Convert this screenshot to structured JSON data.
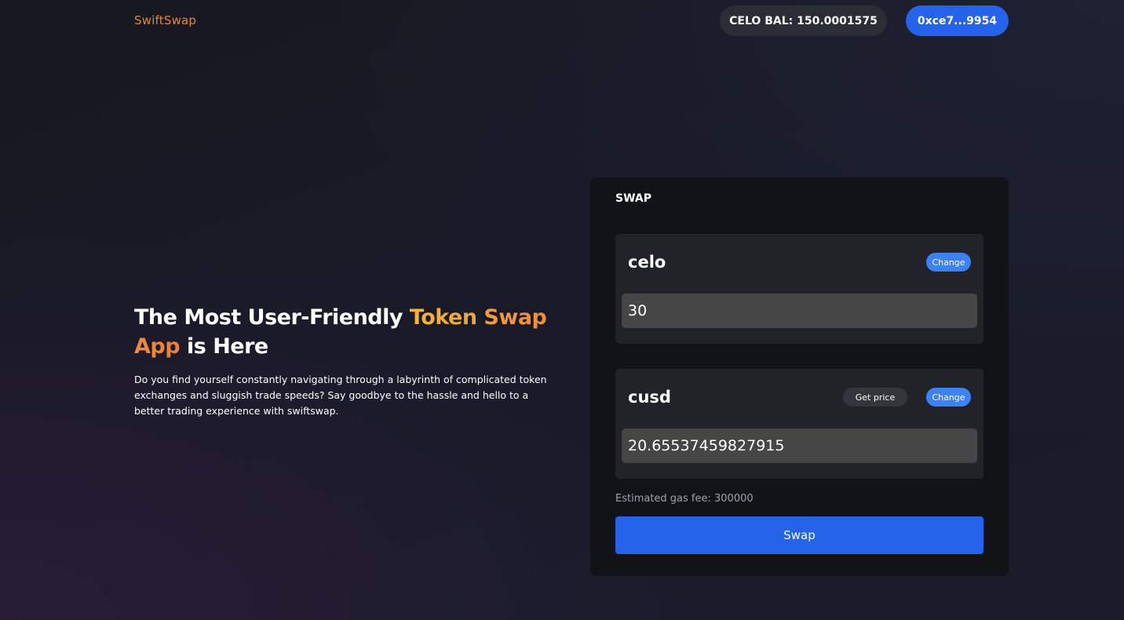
{
  "header": {
    "brand": "SwiftSwap",
    "balance": "CELO BAL: 150.0001575",
    "wallet": "0xce7...9954"
  },
  "hero": {
    "title_part1": "The Most User-Friendly ",
    "title_accent": "Token Swap App",
    "title_part2": " is Here",
    "description": "Do you find yourself constantly navigating through a labyrinth of complicated token exchanges and sluggish trade speeds? Say goodbye to the hassle and hello to a better trading experience with swiftswap."
  },
  "swap": {
    "title": "SWAP",
    "from": {
      "token": "celo",
      "change_label": "Change",
      "amount": "30"
    },
    "to": {
      "token": "cusd",
      "get_price_label": "Get price",
      "change_label": "Change",
      "amount": "20.65537459827915"
    },
    "gas_fee": "Estimated gas fee: 300000",
    "swap_label": "Swap"
  },
  "colors": {
    "brand": "#e0893a",
    "accent_gradient_start": "#f6b53a",
    "accent_gradient_end": "#ee7d3c",
    "primary_button": "#2563eb",
    "change_pill": "#3b82f6"
  }
}
